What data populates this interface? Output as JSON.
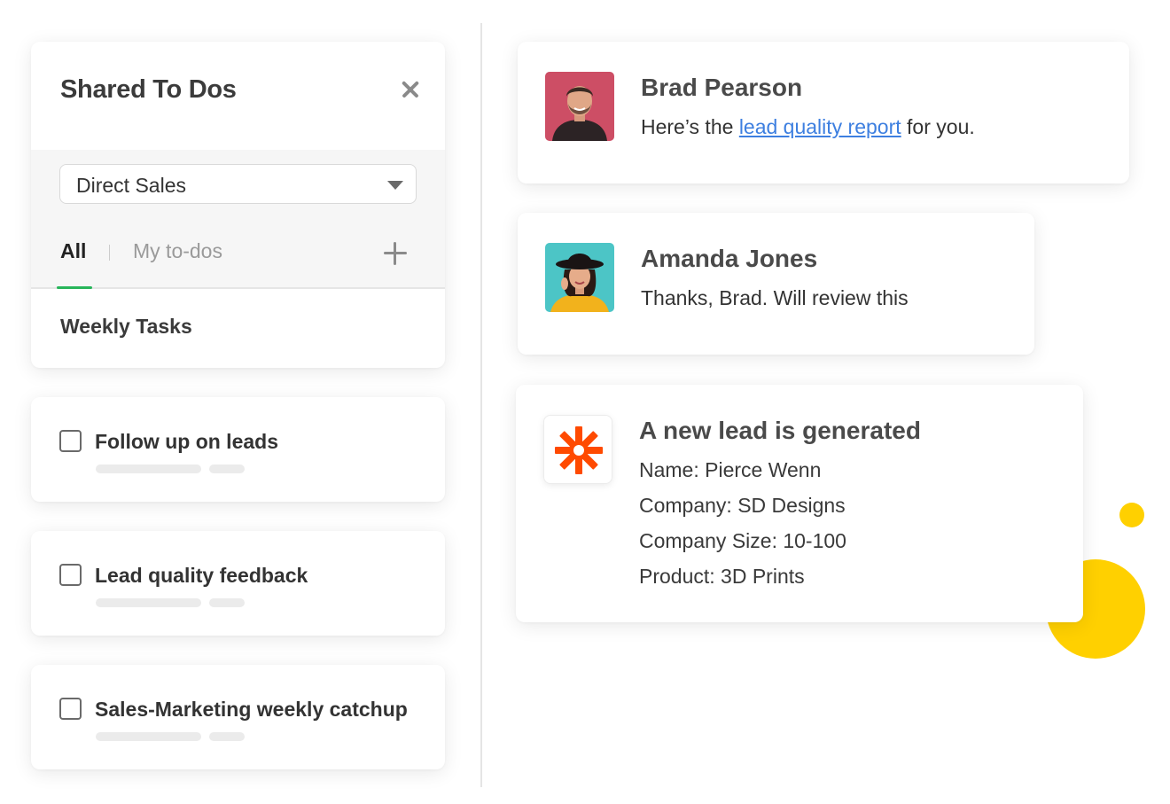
{
  "todo_panel": {
    "title": "Shared To Dos",
    "close_icon": "close-icon",
    "project_select": {
      "selected": "Direct Sales"
    },
    "tabs": [
      {
        "label": "All",
        "active": true
      },
      {
        "label": "My to-dos",
        "active": false
      }
    ],
    "add_icon": "plus-icon",
    "list_title": "Weekly Tasks",
    "accent_color": "#27b55a"
  },
  "tasks": [
    {
      "label": "Follow up on leads",
      "checked": false
    },
    {
      "label": "Lead quality feedback",
      "checked": false
    },
    {
      "label": "Sales-Marketing weekly catchup",
      "checked": false
    }
  ],
  "messages": [
    {
      "name": "Brad Pearson",
      "text_before": "Here’s the ",
      "link_text": "lead quality report",
      "text_after": " for you.",
      "avatar_icon": "man-avatar"
    },
    {
      "name": "Amanda Jones",
      "text": "Thanks, Brad. Will review this",
      "avatar_icon": "woman-avatar"
    }
  ],
  "lead_notification": {
    "icon": "zapier-icon",
    "title": "A new lead is generated",
    "lines": [
      "Name: Pierce Wenn",
      "Company: SD Designs",
      "Company Size: 10-100",
      "Product: 3D Prints"
    ]
  },
  "colors": {
    "link": "#3d7fe0",
    "zapier_orange": "#ff4a00",
    "decor_yellow": "#ffd000"
  }
}
